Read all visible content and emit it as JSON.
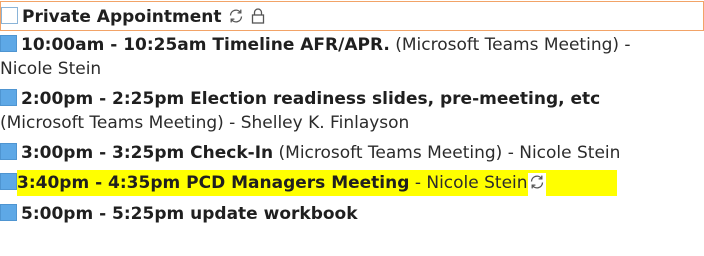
{
  "items": [
    {
      "title": "Private Appointment",
      "icons": [
        "recurring-icon",
        "lock-icon"
      ]
    },
    {
      "time_title": "10:00am - 10:25am Timeline AFR/APR.",
      "details_line1": "(Microsoft Teams Meeting) -",
      "details_line2": "Nicole Stein"
    },
    {
      "time_title": "2:00pm - 2:25pm Election readiness slides, pre-meeting, etc",
      "details_line2": "(Microsoft Teams Meeting) - Shelley K. Finlayson"
    },
    {
      "time_title": "3:00pm - 3:25pm Check-In",
      "details_line1": "(Microsoft Teams Meeting) - Nicole Stein"
    },
    {
      "time_title": "3:40pm - 4:35pm PCD Managers Meeting",
      "details_line1": "- Nicole Stein",
      "highlight_color": "#ffff00",
      "icons": [
        "recurring-icon"
      ]
    },
    {
      "time_title": "5:00pm - 5:25pm update workbook"
    }
  ],
  "colors": {
    "marker_blue": "#5ea8e6",
    "selection_border": "#f2a367",
    "highlight": "#ffff00"
  }
}
